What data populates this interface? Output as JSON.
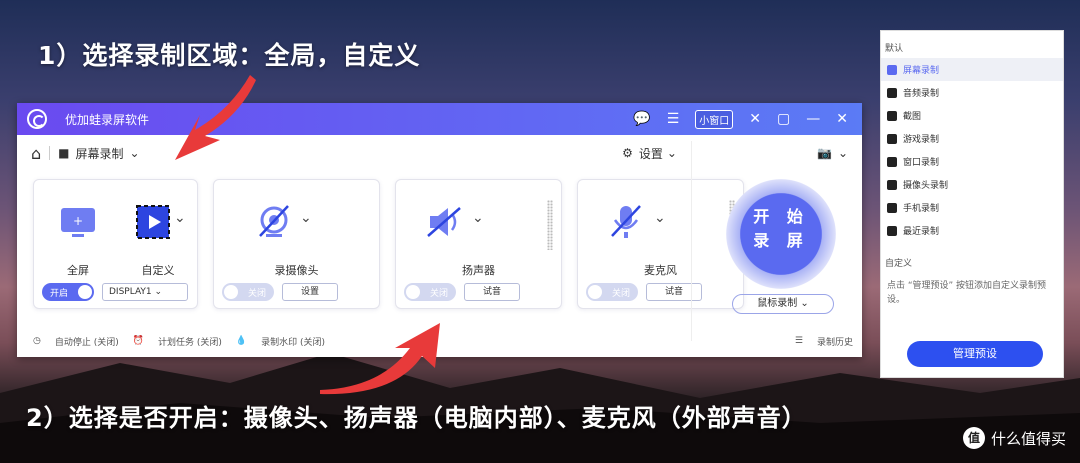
{
  "captions": {
    "top": "1）选择录制区域：全局，自定义",
    "bottom": "2）选择是否开启：摄像头、扬声器（电脑内部）、麦克风（外部声音）"
  },
  "app": {
    "title": "优加蛙录屏软件",
    "mini_window": "小窗口"
  },
  "toolbar": {
    "mode": "屏幕录制",
    "settings": "设置"
  },
  "cards": {
    "fullscreen": {
      "label": "全屏",
      "toggle": "开启",
      "display": "DISPLAY1"
    },
    "custom": {
      "label": "自定义"
    },
    "camera": {
      "label": "录摄像头",
      "toggle": "关闭",
      "button": "设置"
    },
    "speaker": {
      "label": "扬声器",
      "toggle": "关闭",
      "button": "试音"
    },
    "mic": {
      "label": "麦克风",
      "toggle": "关闭",
      "button": "试音"
    }
  },
  "start": {
    "line1": "开 始",
    "line2": "录 屏",
    "mode": "鼠标录制"
  },
  "footer": {
    "auto_stop": "自动停止 (关闭)",
    "schedule": "计划任务 (关闭)",
    "watermark": "录制水印 (关闭)",
    "history": "录制历史"
  },
  "sidepanel": {
    "default_header": "默认",
    "items": [
      "屏幕录制",
      "音频录制",
      "截图",
      "游戏录制",
      "窗口录制",
      "摄像头录制",
      "手机录制",
      "最近录制"
    ],
    "custom_header": "自定义",
    "custom_desc": "点击 “管理预设” 按钮添加自定义录制预设。",
    "manage": "管理预设"
  },
  "watermark": {
    "text": "什么值得买",
    "badge": "值"
  },
  "colors": {
    "accent": "#5b6af0",
    "arrow": "#e83a3a",
    "manage": "#2d50f0"
  }
}
